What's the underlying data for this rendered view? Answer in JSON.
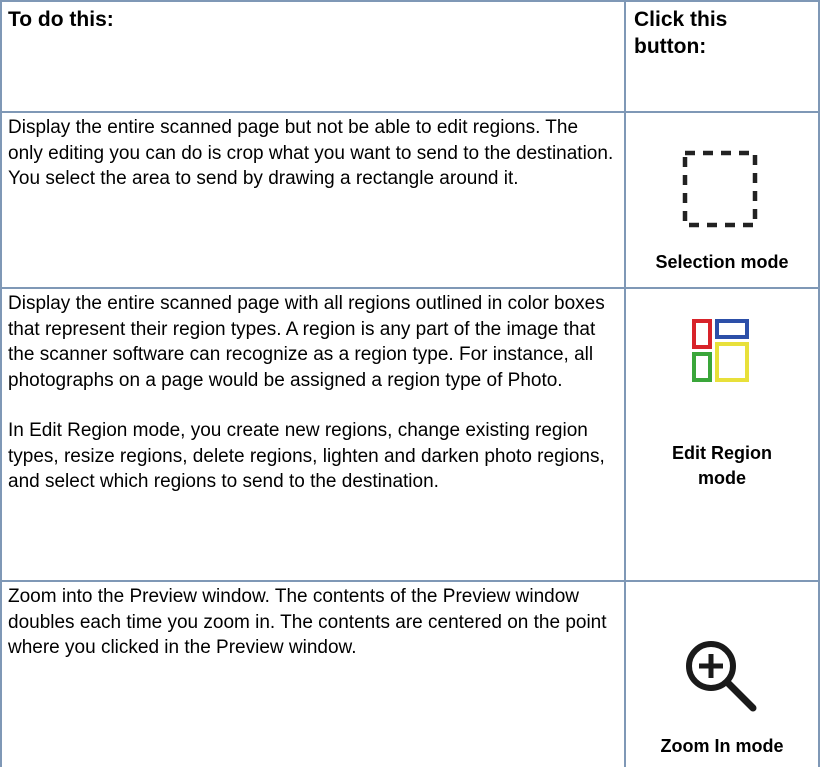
{
  "header": {
    "col1": "To do this:",
    "col2_line1": "Click this",
    "col2_line2": "button:"
  },
  "rows": [
    {
      "description": "Display the entire scanned page but not be able to edit regions. The only editing you can do is crop what you want to send to the destination. You select the area to send by drawing a rectangle around it.",
      "icon": "selection-mode-icon",
      "caption": "Selection mode"
    },
    {
      "description": "Display the entire scanned page with all regions outlined in color boxes that represent their region types. A region is any part of the image that the scanner software can recognize as a region type. For instance, all photographs on a page would be assigned a region type of Photo.",
      "description2": "In Edit Region mode, you create new regions, change existing region types, resize regions, delete regions, lighten and darken photo regions, and select which regions to send to the destination.",
      "icon": "edit-region-icon",
      "caption_line1": "Edit Region",
      "caption_line2": "mode",
      "colors": {
        "red": "#d8232a",
        "blue": "#2c4fa8",
        "green": "#3aa63a",
        "yellow": "#e8e03a"
      }
    },
    {
      "description": "Zoom into the Preview window. The contents of the Preview window doubles each time you zoom in. The contents are centered on the point where you clicked in the Preview window.",
      "icon": "zoom-in-icon",
      "caption": "Zoom In mode"
    }
  ],
  "colors": {
    "rule": "#7f98b6"
  }
}
